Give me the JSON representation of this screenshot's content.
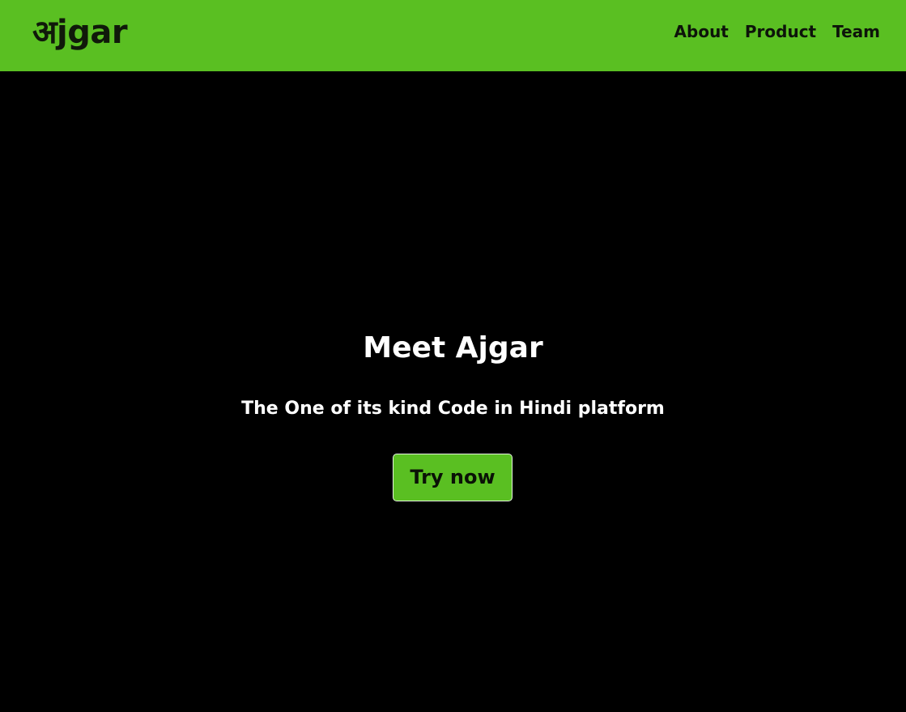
{
  "brand": {
    "logo_text": "अjgar"
  },
  "nav": {
    "items": [
      {
        "label": "About"
      },
      {
        "label": "Product"
      },
      {
        "label": "Team"
      }
    ]
  },
  "hero": {
    "title": "Meet Ajgar",
    "subtitle": "The One of its kind Code in Hindi platform",
    "cta_label": "Try now"
  },
  "colors": {
    "accent": "#5abf22",
    "background": "#000000",
    "hero_text": "#ffffff",
    "nav_text": "#0d140a"
  }
}
